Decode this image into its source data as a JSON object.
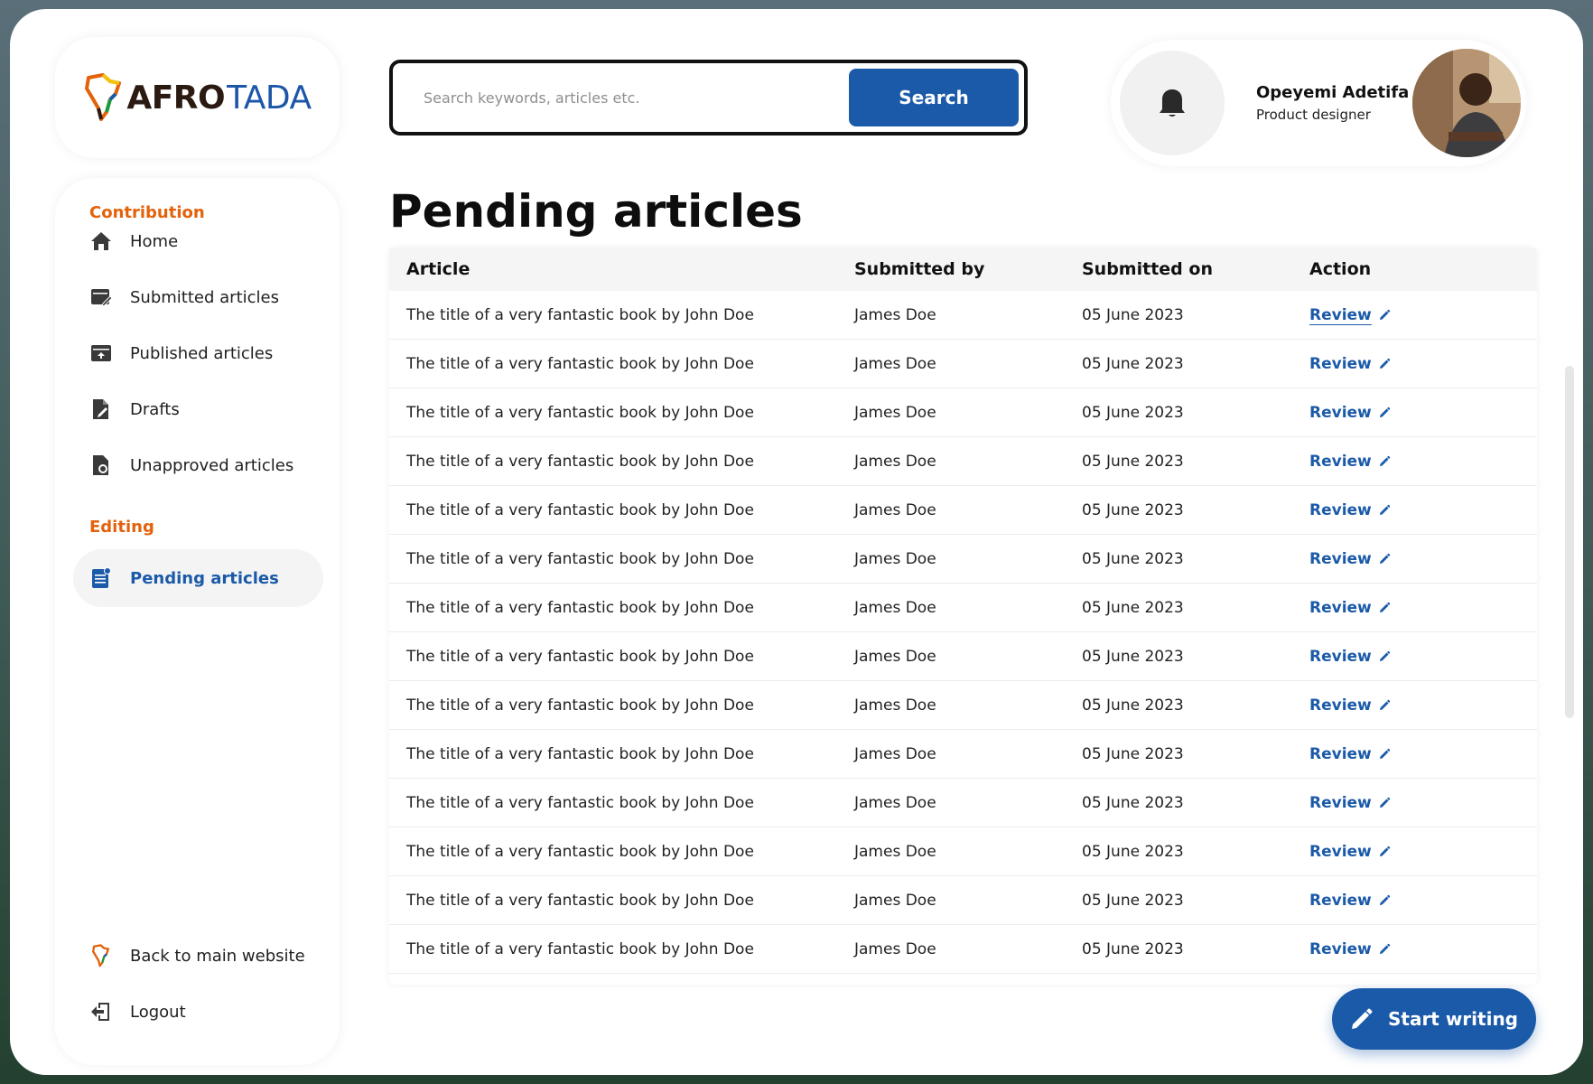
{
  "brand": {
    "name_part1": "AFRO",
    "name_part2": "TADA"
  },
  "search": {
    "placeholder": "Search keywords, articles etc.",
    "button_label": "Search"
  },
  "user": {
    "name": "Opeyemi Adetifa",
    "role": "Product designer"
  },
  "sidebar": {
    "contribution_title": "Contribution",
    "contribution_items": [
      {
        "label": "Home",
        "icon": "home-icon"
      },
      {
        "label": "Submitted articles",
        "icon": "submitted-icon"
      },
      {
        "label": "Published articles",
        "icon": "published-icon"
      },
      {
        "label": "Drafts",
        "icon": "drafts-icon"
      },
      {
        "label": "Unapproved articles",
        "icon": "unapproved-icon"
      }
    ],
    "editing_title": "Editing",
    "editing_items": [
      {
        "label": "Pending articles",
        "icon": "pending-icon",
        "active": true
      }
    ],
    "footer_items": [
      {
        "label": "Back to main website",
        "icon": "africa-logo-icon"
      },
      {
        "label": "Logout",
        "icon": "logout-icon"
      }
    ]
  },
  "main": {
    "title": "Pending articles",
    "table": {
      "headers": [
        "Article",
        "Submitted by",
        "Submitted on",
        "Action"
      ],
      "rows": [
        [
          "The title of  a very fantastic book by John Doe",
          "James Doe",
          "05 June 2023",
          "Review"
        ],
        [
          "The title of  a very fantastic book by John Doe",
          "James Doe",
          "05 June 2023",
          "Review"
        ],
        [
          "The title of  a very fantastic book by John Doe",
          "James Doe",
          "05 June 2023",
          "Review"
        ],
        [
          "The title of  a very fantastic book by John Doe",
          "James Doe",
          "05 June 2023",
          "Review"
        ],
        [
          "The title of  a very fantastic book by John Doe",
          "James Doe",
          "05 June 2023",
          "Review"
        ],
        [
          "The title of  a very fantastic book by John Doe",
          "James Doe",
          "05 June 2023",
          "Review"
        ],
        [
          "The title of  a very fantastic book by John Doe",
          "James Doe",
          "05 June 2023",
          "Review"
        ],
        [
          "The title of  a very fantastic book by John Doe",
          "James Doe",
          "05 June 2023",
          "Review"
        ],
        [
          "The title of  a very fantastic book by John Doe",
          "James Doe",
          "05 June 2023",
          "Review"
        ],
        [
          "The title of  a very fantastic book by John Doe",
          "James Doe",
          "05 June 2023",
          "Review"
        ],
        [
          "The title of  a very fantastic book by John Doe",
          "James Doe",
          "05 June 2023",
          "Review"
        ],
        [
          "The title of  a very fantastic book by John Doe",
          "James Doe",
          "05 June 2023",
          "Review"
        ],
        [
          "The title of  a very fantastic book by John Doe",
          "James Doe",
          "05 June 2023",
          "Review"
        ],
        [
          "The title of  a very fantastic book by John Doe",
          "James Doe",
          "05 June 2023",
          "Review"
        ]
      ]
    },
    "start_writing_label": "Start writing"
  },
  "colors": {
    "accent": "#1b5aa8",
    "section_title": "#e3620b"
  }
}
